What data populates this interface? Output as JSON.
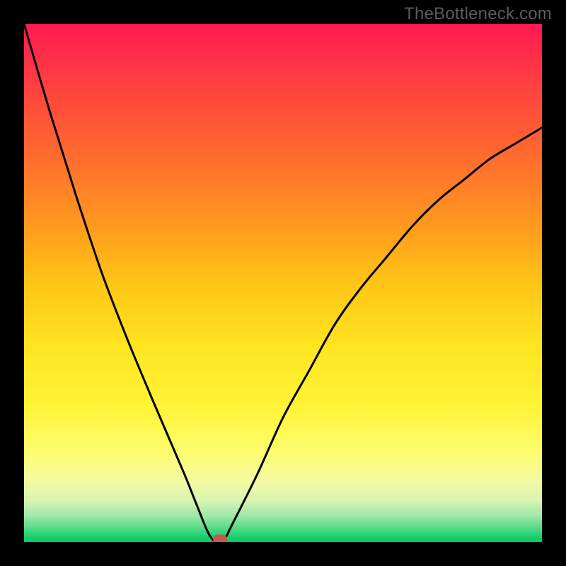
{
  "watermark": "TheBottleneck.com",
  "colors": {
    "curve": "#000000",
    "marker": "#c65a52",
    "frame": "#000000"
  },
  "chart_data": {
    "type": "line",
    "title": "",
    "xlabel": "",
    "ylabel": "",
    "xlim": [
      0,
      100
    ],
    "ylim": [
      0,
      100
    ],
    "grid": false,
    "series": [
      {
        "name": "bottleneck-curve",
        "x": [
          0,
          5,
          10,
          15,
          20,
          25,
          28,
          31,
          33,
          35,
          36,
          37,
          38,
          39,
          40,
          45,
          50,
          55,
          60,
          65,
          70,
          75,
          80,
          85,
          90,
          95,
          100
        ],
        "y": [
          100,
          83,
          67,
          52,
          39,
          27,
          20,
          13,
          8,
          3,
          1,
          0,
          0,
          1,
          3,
          13,
          24,
          33,
          42,
          49,
          55,
          61,
          66,
          70,
          74,
          77,
          80
        ]
      }
    ],
    "annotations": [
      {
        "name": "optimal-marker",
        "x": 37.8,
        "y": 0.5
      }
    ]
  }
}
